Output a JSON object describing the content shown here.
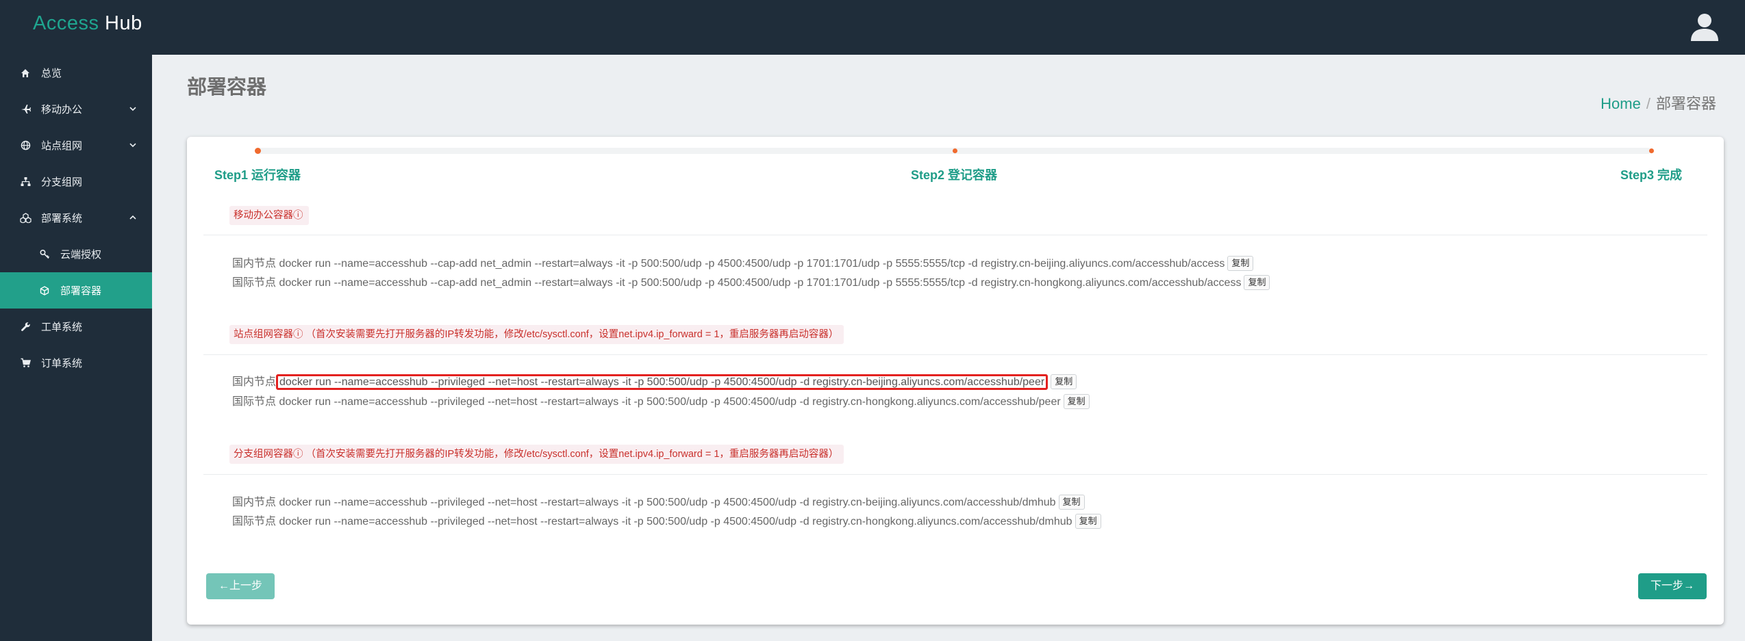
{
  "app": {
    "brand_part1": "Access",
    "brand_part2": "Hub",
    "user_icon": "user-icon"
  },
  "sidebar": {
    "items": [
      {
        "label": "总览",
        "icon": "home-icon"
      },
      {
        "label": "移动办公",
        "icon": "plane-icon",
        "has_chevron": true
      },
      {
        "label": "站点组网",
        "icon": "globe-icon",
        "has_chevron": true
      },
      {
        "label": "分支组网",
        "icon": "sitemap-icon"
      },
      {
        "label": "部署系统",
        "icon": "cubes-icon",
        "has_chevron": true,
        "expanded": true
      },
      {
        "label": "云端授权",
        "icon": "key-icon",
        "sub": true
      },
      {
        "label": "部署容器",
        "icon": "cube-icon",
        "sub": true,
        "active": true
      },
      {
        "label": "工单系统",
        "icon": "wrench-icon"
      },
      {
        "label": "订单系统",
        "icon": "cart-icon"
      }
    ]
  },
  "page": {
    "title": "部署容器",
    "breadcrumb": {
      "home": "Home",
      "sep": "/",
      "current": "部署容器"
    }
  },
  "steps": [
    {
      "label": "Step1 运行容器"
    },
    {
      "label": "Step2 登记容器"
    },
    {
      "label": "Step3 完成"
    }
  ],
  "sections": [
    {
      "tag": "移动办公容器ⓘ",
      "lines": [
        {
          "prefix": "国内节点",
          "cmd": "docker run --name=accesshub --cap-add net_admin --restart=always -it -p 500:500/udp -p 4500:4500/udp -p 1701:1701/udp -p 5555:5555/tcp -d registry.cn-beijing.aliyuncs.com/accesshub/access",
          "copy": "复制"
        },
        {
          "prefix": "国际节点",
          "cmd": "docker run --name=accesshub --cap-add net_admin --restart=always -it -p 500:500/udp -p 4500:4500/udp -p 1701:1701/udp -p 5555:5555/tcp -d registry.cn-hongkong.aliyuncs.com/accesshub/access",
          "copy": "复制"
        }
      ]
    },
    {
      "tag": "站点组网容器ⓘ （首次安装需要先打开服务器的IP转发功能，修改/etc/sysctl.conf，设置net.ipv4.ip_forward = 1，重启服务器再启动容器）",
      "lines": [
        {
          "prefix": "国内节点",
          "cmd": "docker run --name=accesshub --privileged --net=host --restart=always -it -p 500:500/udp -p 4500:4500/udp -d registry.cn-beijing.aliyuncs.com/accesshub/peer",
          "copy": "复制",
          "highlighted": true
        },
        {
          "prefix": "国际节点",
          "cmd": "docker run --name=accesshub --privileged --net=host --restart=always -it -p 500:500/udp -p 4500:4500/udp -d registry.cn-hongkong.aliyuncs.com/accesshub/peer",
          "copy": "复制"
        }
      ]
    },
    {
      "tag": "分支组网容器ⓘ （首次安装需要先打开服务器的IP转发功能，修改/etc/sysctl.conf，设置net.ipv4.ip_forward = 1，重启服务器再启动容器）",
      "lines": [
        {
          "prefix": "国内节点",
          "cmd": "docker run --name=accesshub --privileged --net=host --restart=always -it -p 500:500/udp -p 4500:4500/udp -d registry.cn-beijing.aliyuncs.com/accesshub/dmhub",
          "copy": "复制"
        },
        {
          "prefix": "国际节点",
          "cmd": "docker run --name=accesshub --privileged --net=host --restart=always -it -p 500:500/udp -p 4500:4500/udp -d registry.cn-hongkong.aliyuncs.com/accesshub/dmhub",
          "copy": "复制"
        }
      ]
    }
  ],
  "buttons": {
    "prev": "←上一步",
    "next": "下一步→"
  },
  "colors": {
    "topbar": "#1f2d3a",
    "accent": "#1f9d88",
    "tag_text": "#c9302c",
    "highlight_border": "#e3211f",
    "step_dot": "#f06a2e"
  }
}
